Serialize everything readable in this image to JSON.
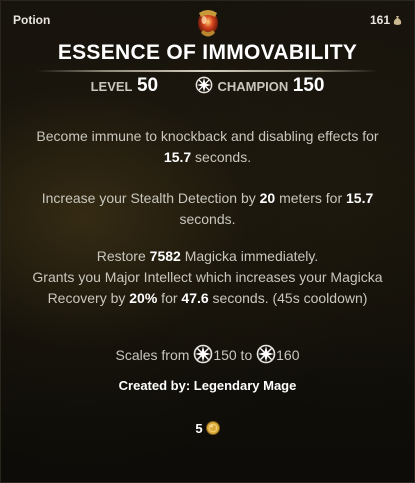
{
  "item": {
    "type": "Potion",
    "count": "161",
    "name": "ESSENCE OF IMMOVABILITY",
    "level_label": "LEVEL",
    "level_value": "50",
    "champion_label": "CHAMPION",
    "champion_value": "150"
  },
  "effects": {
    "p1_a": "Become immune to knockback and disabling effects for ",
    "p1_b": "15.7",
    "p1_c": " seconds.",
    "p2_a": "Increase your Stealth Detection by ",
    "p2_b": "20",
    "p2_c": " meters for ",
    "p2_d": "15.7",
    "p2_e": " seconds.",
    "p3_a": "Restore ",
    "p3_b": "7582",
    "p3_c": " Magicka immediately.",
    "p3_d": "Grants you Major Intellect which increases your Magicka Recovery by ",
    "p3_e": "20%",
    "p3_f": " for ",
    "p3_g": "47.6",
    "p3_h": " seconds. (45s cooldown)"
  },
  "scales": {
    "prefix": "Scales from ",
    "from": "150",
    "mid": " to ",
    "to": "160"
  },
  "creator": "Created by: Legendary Mage",
  "value": "5",
  "icons": {
    "potion": "potion-icon",
    "bag": "bag-icon",
    "champion": "champion-point-icon",
    "coin": "gold-coin-icon"
  },
  "colors": {
    "highlight": "#ffffff",
    "body": "#c8c6bd",
    "gold": "#d9a93a"
  }
}
